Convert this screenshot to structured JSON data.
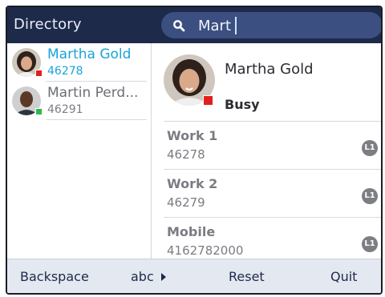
{
  "header": {
    "title": "Directory"
  },
  "search": {
    "value": "Mart",
    "icon": "search-icon"
  },
  "contacts": [
    {
      "name": "Martha Gold",
      "number": "46278",
      "presence": "busy",
      "presence_color": "#e0201e"
    },
    {
      "name": "Martin Perd...",
      "number": "46291",
      "presence": "available",
      "presence_color": "#2fb84a"
    }
  ],
  "detail": {
    "name": "Martha Gold",
    "status": "Busy",
    "presence_color": "#e0201e",
    "numbers": [
      {
        "label": "Work 1",
        "value": "46278",
        "line": "L1"
      },
      {
        "label": "Work 2",
        "value": "46279",
        "line": "L1"
      },
      {
        "label": "Mobile",
        "value": "4162782000",
        "line": "L1"
      }
    ]
  },
  "softkeys": {
    "backspace": "Backspace",
    "abc": "abc",
    "reset": "Reset",
    "quit": "Quit"
  },
  "colors": {
    "accent": "#1aa3d9",
    "header_bg": "#1d2a4a",
    "search_bg": "#3b4f80",
    "softkey_bg": "#e4e8f1"
  }
}
